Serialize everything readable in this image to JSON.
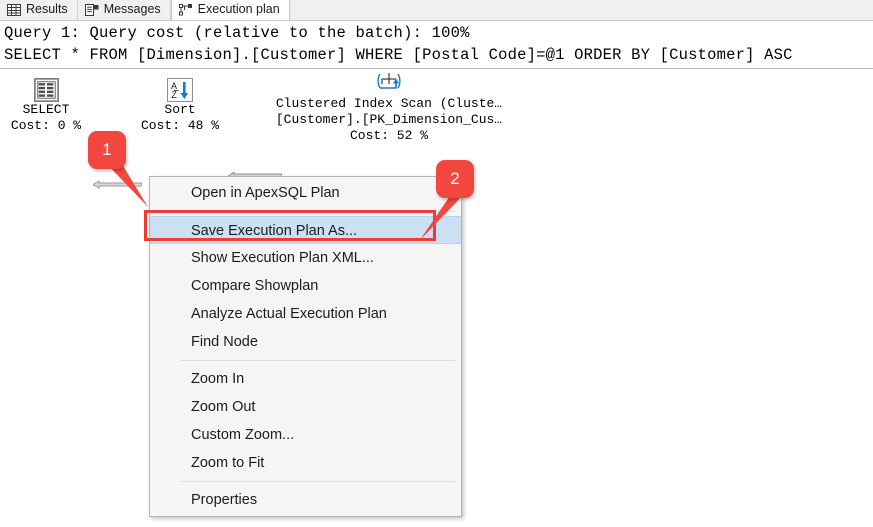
{
  "tabs": [
    {
      "label": "Results",
      "icon": "grid-icon",
      "active": false
    },
    {
      "label": "Messages",
      "icon": "message-list-icon",
      "active": false
    },
    {
      "label": "Execution plan",
      "icon": "execution-plan-icon",
      "active": true
    }
  ],
  "query": {
    "line1": "Query 1: Query cost (relative to the batch): 100%",
    "line2": "SELECT * FROM [Dimension].[Customer] WHERE [Postal Code]=@1 ORDER BY [Customer] ASC",
    "cost_relative_to_batch": "100%"
  },
  "plan": {
    "nodes": [
      {
        "id": "select",
        "icon": "result-grid-icon",
        "label": "SELECT",
        "cost": "Cost: 0 %"
      },
      {
        "id": "sort",
        "icon": "sort-az-icon",
        "label": "Sort",
        "cost": "Cost: 48 %"
      },
      {
        "id": "clustered-index-scan",
        "icon": "clustered-index-scan-icon",
        "label_line1": "Clustered Index Scan (Cluste…",
        "label_line2": "[Customer].[PK_Dimension_Cus…",
        "cost": "Cost: 52 %"
      }
    ]
  },
  "context_menu": {
    "items": [
      {
        "label": "Open in ApexSQL Plan",
        "selected": false,
        "separator_after": true
      },
      {
        "label": "Save Execution Plan As...",
        "selected": true,
        "separator_after": false
      },
      {
        "label": "Show Execution Plan XML...",
        "selected": false,
        "separator_after": false
      },
      {
        "label": "Compare Showplan",
        "selected": false,
        "separator_after": false
      },
      {
        "label": "Analyze Actual Execution Plan",
        "selected": false,
        "separator_after": false
      },
      {
        "label": "Find Node",
        "selected": false,
        "separator_after": true
      },
      {
        "label": "Zoom In",
        "selected": false,
        "separator_after": false
      },
      {
        "label": "Zoom Out",
        "selected": false,
        "separator_after": false
      },
      {
        "label": "Custom Zoom...",
        "selected": false,
        "separator_after": false
      },
      {
        "label": "Zoom to Fit",
        "selected": false,
        "separator_after": true
      },
      {
        "label": "Properties",
        "selected": false,
        "separator_after": false
      }
    ]
  },
  "callouts": [
    {
      "number": "1"
    },
    {
      "number": "2"
    }
  ],
  "colors": {
    "callout_red": "#f3463f",
    "highlight_border_red": "#ee3b33",
    "menu_selection_blue": "#cbe0f2",
    "menu_background": "#f5f5f5",
    "tabbar_background": "#eff0f1",
    "sort_arrow_blue": "#1a7ad1"
  }
}
